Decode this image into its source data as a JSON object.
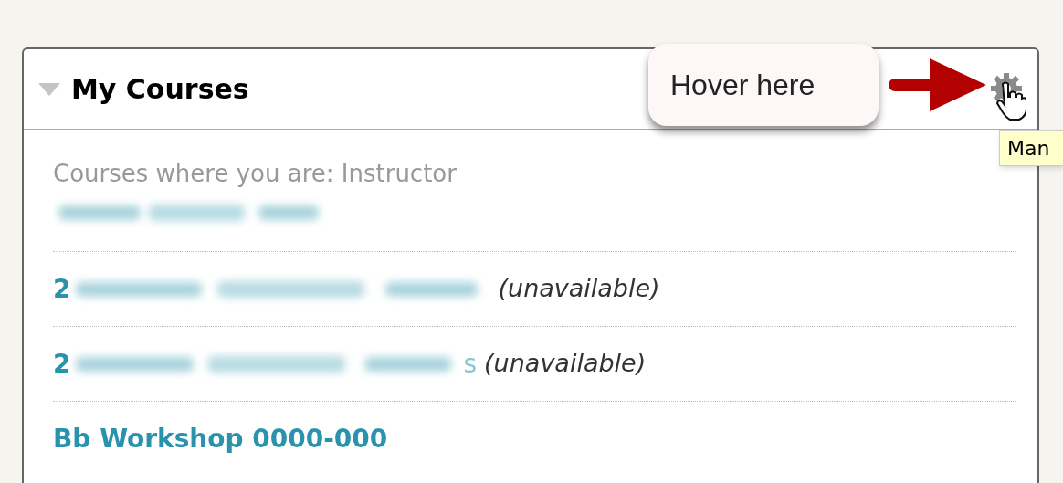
{
  "panel": {
    "title": "My Courses",
    "expanded": true,
    "role_heading": "Courses where you are: Instructor",
    "courses": [
      {
        "kind": "blurred"
      },
      {
        "kind": "blurred",
        "visible_start": "2",
        "note": "(unavailable)"
      },
      {
        "kind": "blurred",
        "visible_start": "2",
        "visible_end": "s",
        "note": "(unavailable)"
      },
      {
        "kind": "link",
        "label": "Bb Workshop 0000-000"
      }
    ]
  },
  "callout": {
    "text": "Hover here"
  },
  "tooltip": {
    "text": "Man"
  }
}
